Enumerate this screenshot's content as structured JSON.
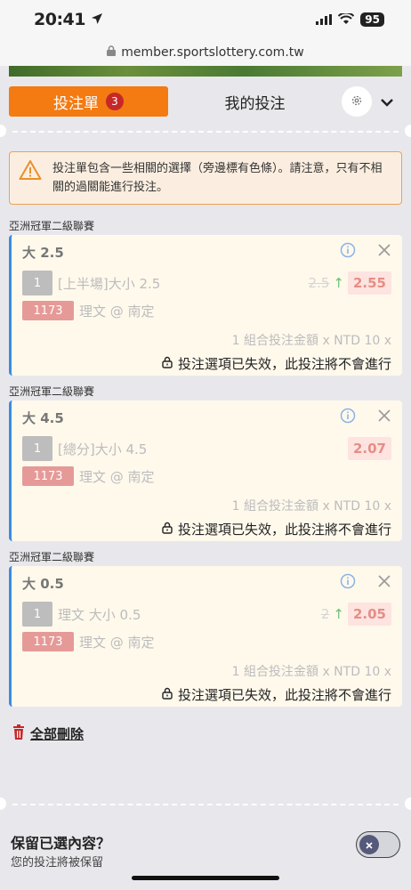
{
  "status_bar": {
    "time": "20:41",
    "battery": "95"
  },
  "browser": {
    "url": "member.sportslottery.com.tw"
  },
  "tabs": {
    "active_label": "投注單",
    "active_count": "3",
    "inactive_label": "我的投注"
  },
  "notice": {
    "text": "投注單包含一些相關的選擇（旁邊標有色條）。請注意，只有不相關的過關能進行投注。"
  },
  "bets": [
    {
      "league": "亞洲冠軍二級聯賽",
      "title": "大 2.5",
      "leg_number": "1",
      "market": "[上半場]大小 2.5",
      "old_odds": "2.5",
      "odds": "2.55",
      "match_id": "1173",
      "match": "理文 @ 南定",
      "combo": "1 組合投注金額 x NTD 10 x",
      "invalid": "投注選項已失效，此投注將不會進行"
    },
    {
      "league": "亞洲冠軍二級聯賽",
      "title": "大 4.5",
      "leg_number": "1",
      "market": "[總分]大小 4.5",
      "old_odds": "",
      "odds": "2.07",
      "match_id": "1173",
      "match": "理文 @ 南定",
      "combo": "1 組合投注金額 x NTD 10 x",
      "invalid": "投注選項已失效，此投注將不會進行"
    },
    {
      "league": "亞洲冠軍二級聯賽",
      "title": "大 0.5",
      "leg_number": "1",
      "market": "理文 大小 0.5",
      "old_odds": "2",
      "odds": "2.05",
      "match_id": "1173",
      "match": "理文 @ 南定",
      "combo": "1 組合投注金額 x NTD 10 x",
      "invalid": "投注選項已失效，此投注將不會進行"
    }
  ],
  "actions": {
    "delete_all": "全部刪除"
  },
  "keep": {
    "title": "保留已選內容？",
    "subtitle": "您的投注將被保留"
  },
  "colors": {
    "accent": "#f47a12",
    "badge": "#c62828",
    "card_bg": "#fff9ec",
    "card_border": "#3d8be0",
    "odds_bg": "#fde4e0",
    "team_badge": "#e59a98"
  }
}
